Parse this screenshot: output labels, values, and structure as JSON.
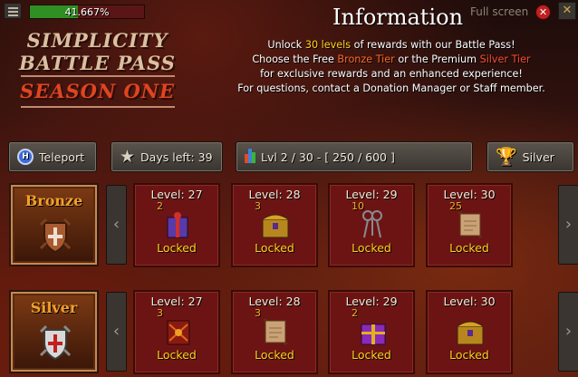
{
  "header": {
    "progress_text": "41.667%",
    "progress_fraction": 0.41667,
    "fullscreen_label": "Full screen",
    "close_label": "✕"
  },
  "logo": {
    "line1": "SIMPLICITY",
    "line2": "BATTLE PASS",
    "line3": "SEASON ONE"
  },
  "info": {
    "title": "Information",
    "line1": {
      "a": "Unlock ",
      "b": "30 levels",
      "c": " of rewards with our Battle Pass!"
    },
    "line2": {
      "a": "Choose the Free ",
      "b": "Bronze Tier",
      "c": " or the Premium ",
      "d": "Silver Tier"
    },
    "line3": "for exclusive rewards and an enhanced experience!",
    "line4": "For questions, contact a Donation Manager or Staff member."
  },
  "controls": {
    "teleport": "Teleport",
    "days_left": "Days left: 39",
    "level_progress": "Lvl 2 / 30 - [ 250 / 600 ]",
    "tier": "Silver"
  },
  "rows": {
    "bronze": {
      "label": "Bronze",
      "rewards": [
        {
          "level": "Level: 27",
          "qty": "2",
          "status": "Locked",
          "icon": "mystery-box-icon"
        },
        {
          "level": "Level: 28",
          "qty": "3",
          "status": "Locked",
          "icon": "treasure-chest-icon"
        },
        {
          "level": "Level: 29",
          "qty": "10",
          "status": "Locked",
          "icon": "keys-icon"
        },
        {
          "level": "Level: 30",
          "qty": "25",
          "status": "Locked",
          "icon": "scroll-icon"
        }
      ]
    },
    "silver": {
      "label": "Silver",
      "rewards": [
        {
          "level": "Level: 27",
          "qty": "3",
          "status": "Locked",
          "icon": "infernal-box-icon"
        },
        {
          "level": "Level: 28",
          "qty": "3",
          "status": "Locked",
          "icon": "scroll-icon"
        },
        {
          "level": "Level: 29",
          "qty": "2",
          "status": "Locked",
          "icon": "gift-box-icon"
        },
        {
          "level": "Level: 30",
          "qty": "",
          "status": "Locked",
          "icon": "treasure-chest-icon"
        }
      ]
    }
  },
  "colors": {
    "accent_yellow": "#ffd21e",
    "bronze_orange": "#ff6a28",
    "silver_red": "#ff4a30",
    "progress_green": "#2f8f22"
  }
}
